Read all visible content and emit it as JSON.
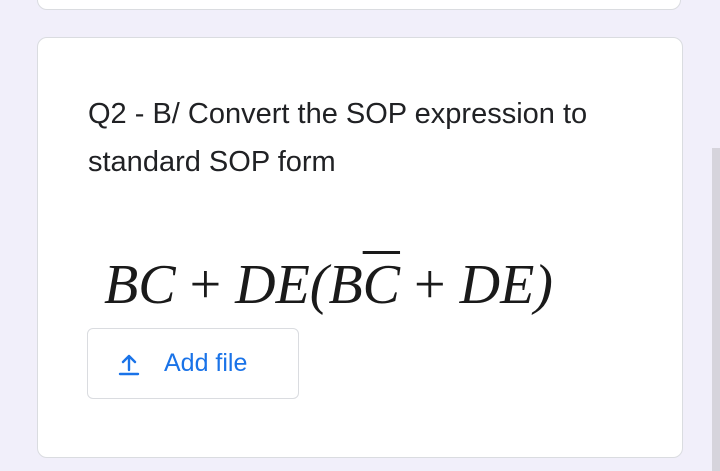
{
  "question": {
    "text": "Q2 - B/ Convert the SOP expression to standard SOP form"
  },
  "formula": {
    "part1": "BC",
    "op1": " + ",
    "part2": "DE(B",
    "overlined": "C",
    "op2": " + ",
    "part3": "DE)"
  },
  "upload": {
    "icon": "upload-icon",
    "label": "Add file"
  },
  "colors": {
    "accent": "#1a73e8",
    "background": "#f1effa"
  }
}
